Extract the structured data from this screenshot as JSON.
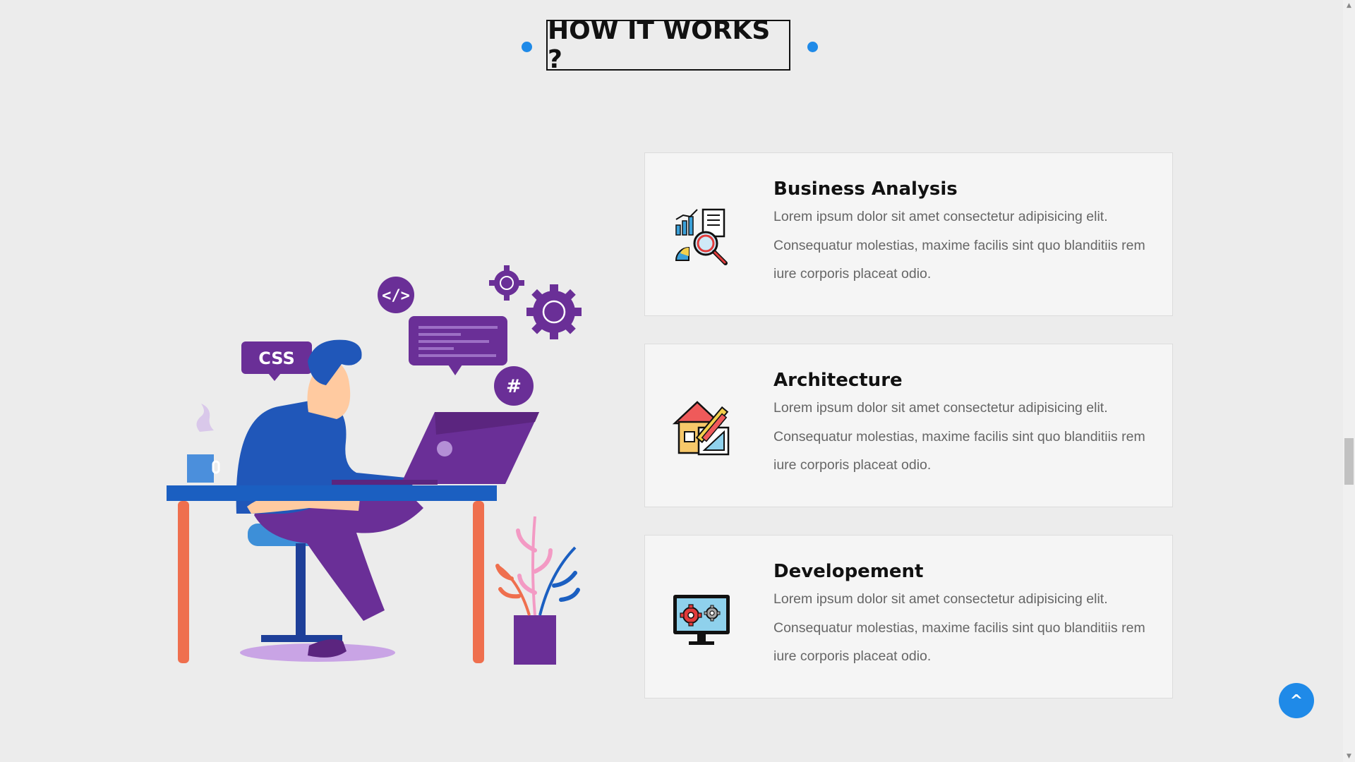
{
  "section": {
    "title": "HOW IT WORKS ?",
    "accent_color": "#1f8ae8"
  },
  "illustration": {
    "name": "developer-at-desk-illustration",
    "bubble_css": "CSS",
    "bubble_code": "</>",
    "bubble_hash": "#"
  },
  "cards": [
    {
      "icon": "business-analysis-icon",
      "title": "Business Analysis",
      "text": "Lorem ipsum dolor sit amet consectetur adipisicing elit. Consequatur molestias, maxime facilis sint quo blanditiis rem iure corporis placeat odio."
    },
    {
      "icon": "architecture-icon",
      "title": "Architecture",
      "text": "Lorem ipsum dolor sit amet consectetur adipisicing elit. Consequatur molestias, maxime facilis sint quo blanditiis rem iure corporis placeat odio."
    },
    {
      "icon": "development-icon",
      "title": "Developement",
      "text": "Lorem ipsum dolor sit amet consectetur adipisicing elit. Consequatur molestias, maxime facilis sint quo blanditiis rem iure corporis placeat odio."
    }
  ],
  "back_to_top": {
    "glyph": "^",
    "icon": "chevron-up-icon"
  },
  "scrollbar": {
    "up_arrow": "▲",
    "down_arrow": "▼"
  }
}
